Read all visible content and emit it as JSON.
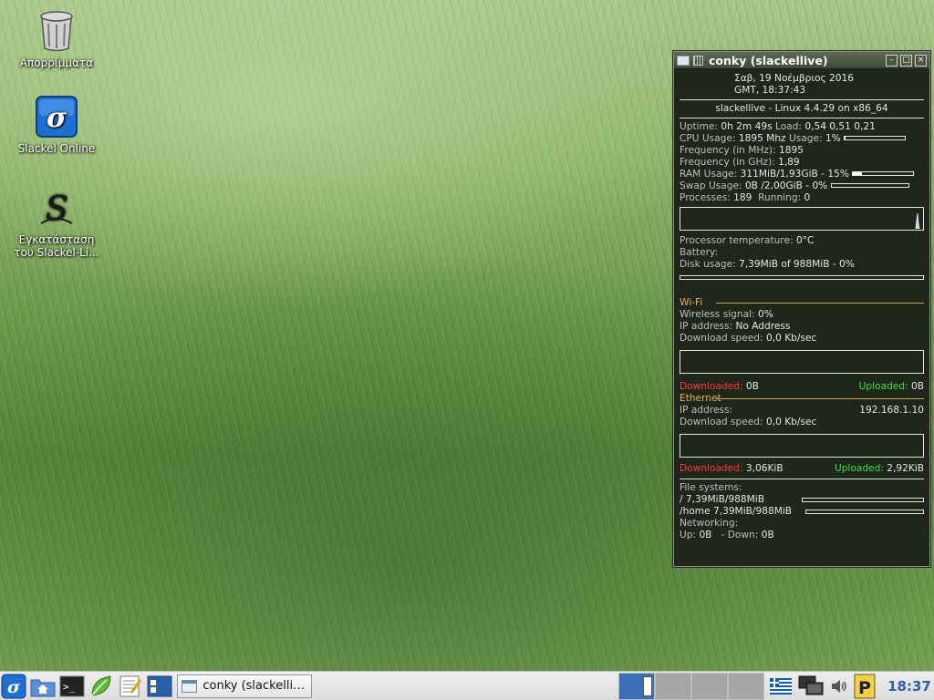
{
  "desktop": {
    "icons": [
      {
        "label": "Απορρίμματα",
        "icon": "trash-icon"
      },
      {
        "label": "Slackel Online",
        "icon": "slackel-online-icon"
      },
      {
        "label": "Εγκατάσταση του Slackel-Li...",
        "icon": "slackel-installer-icon"
      }
    ]
  },
  "conky": {
    "title": "conky (slackellive)",
    "date_line": "Σαβ,  19 Νοέμβριος 2016",
    "time_line": "GMT,     18:37:43",
    "host_line": "slackellive - Linux 4.4.29 on x86_64",
    "uptime_label": "Uptime:",
    "uptime_value": "0h 2m 49s",
    "load_label": "Load:",
    "load_value": "0,54 0,51 0,21",
    "cpu_label": "CPU Usage:",
    "cpu_freq": "1895 Mhz",
    "cpu_usage_label": "Usage:",
    "cpu_usage_value": "1%",
    "cpu_usage_fraction": 0.01,
    "freq_mhz_label": "Frequency (in MHz):",
    "freq_mhz_value": "1895",
    "freq_ghz_label": "Frequency (in GHz):",
    "freq_ghz_value": "1,89",
    "ram_label": "RAM Usage:",
    "ram_value": "311MiB/1,93GiB - 15%",
    "ram_fraction": 0.15,
    "swap_label": "Swap Usage:",
    "swap_value": "0B  /2,00GiB - 0%",
    "swap_fraction": 0.0,
    "proc_label": "Processes:",
    "proc_value": "189",
    "running_label": "Running:",
    "running_value": "0",
    "temp_label": "Processor temperature:",
    "temp_value": "0°C",
    "battery_label": "Battery:",
    "disk_label": "Disk usage:",
    "disk_value": "7,39MiB of 988MiB - 0%",
    "disk_fraction": 0.0,
    "wifi_title": "Wi-Fi",
    "wifi_signal_label": "Wireless signal:",
    "wifi_signal_value": "0%",
    "wifi_ip_label": "IP address:",
    "wifi_ip_value": "No Address",
    "wifi_dl_label": "Download speed:",
    "wifi_dl_value": "0,0 Kb/sec",
    "wifi_downloaded_label": "Downloaded:",
    "wifi_downloaded_value": "0B",
    "wifi_uploaded_label": "Uploaded:",
    "wifi_uploaded_value": "0B",
    "eth_title": "Ethernet",
    "eth_ip_label": "IP address:",
    "eth_ip_value": "192.168.1.10",
    "eth_dl_label": "Download speed:",
    "eth_dl_value": "0,0 Kb/sec",
    "eth_downloaded_label": "Downloaded:",
    "eth_downloaded_value": "3,06KiB",
    "eth_uploaded_label": "Uploaded:",
    "eth_uploaded_value": "2,92KiB",
    "fs_label": "File systems:",
    "fs_root": " / 7,39MiB/988MiB",
    "fs_root_fraction": 0.0,
    "fs_home": "/home 7,39MiB/988MiB",
    "fs_home_fraction": 0.0,
    "net_label": "Networking:",
    "net_up_label": " Up:",
    "net_up_value": "0B",
    "net_down_label": "- Down:",
    "net_down_value": "0B"
  },
  "taskbar": {
    "task_label": "conky (slackellive)",
    "active_workspace": 1,
    "clock": "18:37"
  }
}
